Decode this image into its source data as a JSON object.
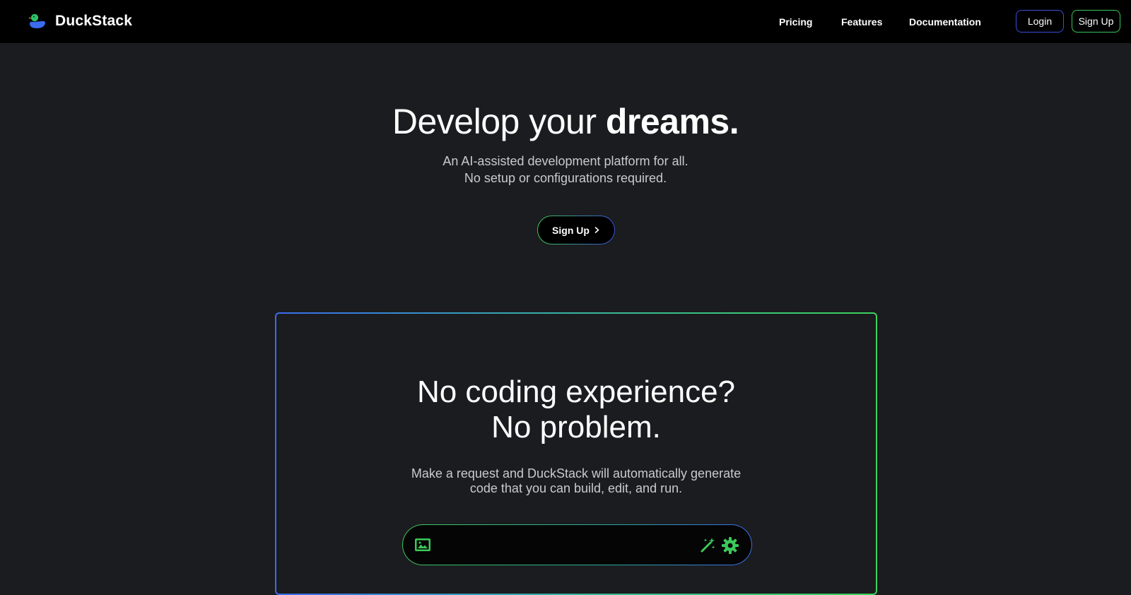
{
  "brand": {
    "name": "DuckStack",
    "logo_icon": "duck-logo-icon",
    "colors": {
      "head": "#2bc26a",
      "body": "#3a6cf0",
      "beak": "#f0b400"
    }
  },
  "nav": {
    "links": [
      {
        "label": "Pricing"
      },
      {
        "label": "Features"
      },
      {
        "label": "Documentation"
      }
    ],
    "login_label": "Login",
    "signup_label": "Sign Up"
  },
  "hero": {
    "title_prefix": "Develop your ",
    "title_bold": "dreams.",
    "subtitle_line1": "An AI-assisted development platform for all.",
    "subtitle_line2": "No setup or configurations required.",
    "cta_label": "Sign Up",
    "cta_icon": "chevron-right-icon"
  },
  "feature_card": {
    "title_line1": "No coding experience?",
    "title_line2": "No problem.",
    "subtitle_line1": "Make a request and DuckStack will automatically generate",
    "subtitle_line2": "code that you can build, edit, and run.",
    "prompt": {
      "value": "",
      "placeholder": "",
      "icons": [
        "image-icon",
        "magic-wand-icon",
        "gear-icon"
      ]
    }
  },
  "colors": {
    "page_bg": "#1b1c1f",
    "nav_bg": "#000000",
    "accent_green": "#3cc85a",
    "accent_blue": "#3a4fd8",
    "icon_green": "#3cc85a"
  }
}
